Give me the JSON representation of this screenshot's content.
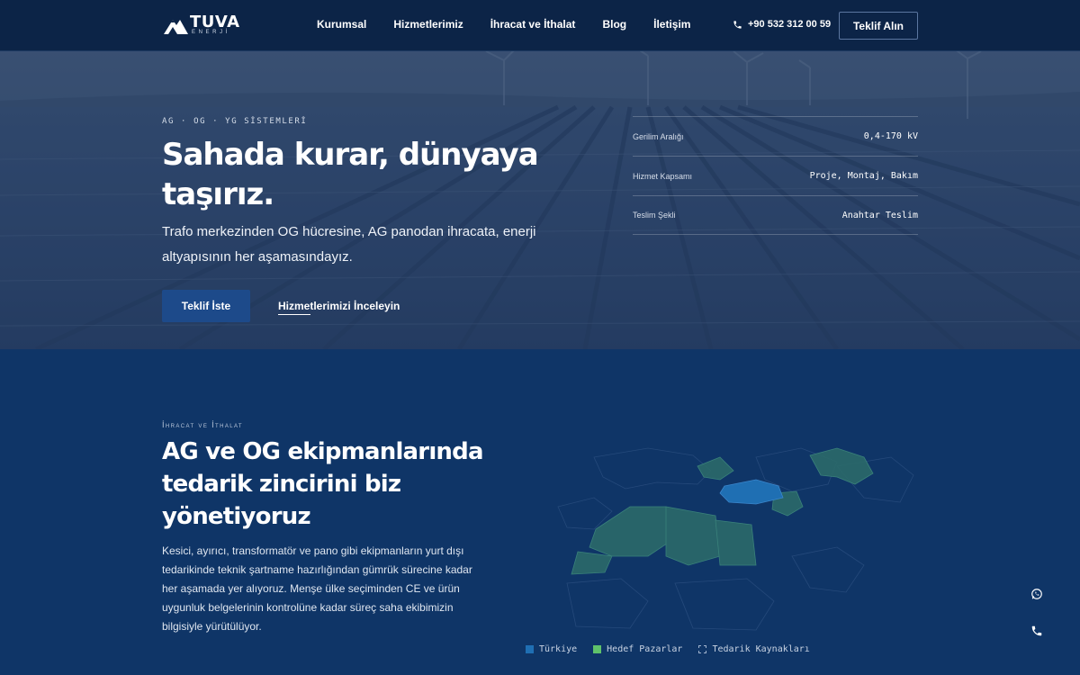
{
  "brand": {
    "name": "TUVA",
    "sub": "ENERJİ"
  },
  "nav": {
    "items": [
      "Kurumsal",
      "Hizmetlerimiz",
      "İhracat ve İthalat",
      "Blog",
      "İletişim"
    ],
    "phone": "+90 532 312 00 59",
    "cta": "Teklif Alın"
  },
  "hero": {
    "eyebrow": "AG · OG · YG SİSTEMLERİ",
    "title": "Sahada kurar, dünyaya taşırız.",
    "description": "Trafo merkezinden OG hücresine, AG panodan ihracata, enerji altyapısının her aşamasındayız.",
    "primary_cta": "Teklif İste",
    "secondary_cta": "Hizmetlerimizi İnceleyin",
    "specs": [
      {
        "label": "Gerilim Aralığı",
        "value": "0,4-170 kV"
      },
      {
        "label": "Hizmet Kapsamı",
        "value": "Proje, Montaj, Bakım"
      },
      {
        "label": "Teslim Şekli",
        "value": "Anahtar Teslim"
      }
    ]
  },
  "trade": {
    "eyebrow": "İhracat ve İthalat",
    "title": "AG ve OG ekipmanlarında tedarik zincirini biz yönetiyoruz",
    "description": "Kesici, ayırıcı, transformatör ve pano gibi ekipmanların yurt dışı tedarikinde teknik şartname hazırlığından gümrük sürecine kadar her aşamada yer alıyoruz. Menşe ülke seçiminden CE ve ürün uygunluk belgelerinin kontrolüne kadar süreç saha ekibimizin bilgisiyle yürütülüyor.",
    "legend": [
      {
        "label": "Türkiye",
        "color": "#1f6fb3"
      },
      {
        "label": "Hedef Pazarlar",
        "color": "#5fc26a"
      },
      {
        "label": "Tedarik Kaynakları",
        "color": "transparent"
      }
    ]
  },
  "icons": {
    "whatsapp": "whatsapp-icon",
    "phone": "phone-icon"
  },
  "colors": {
    "nav_bg": "#0c2447",
    "section_bg": "#0f3567",
    "primary_button": "#1d4a8a"
  }
}
